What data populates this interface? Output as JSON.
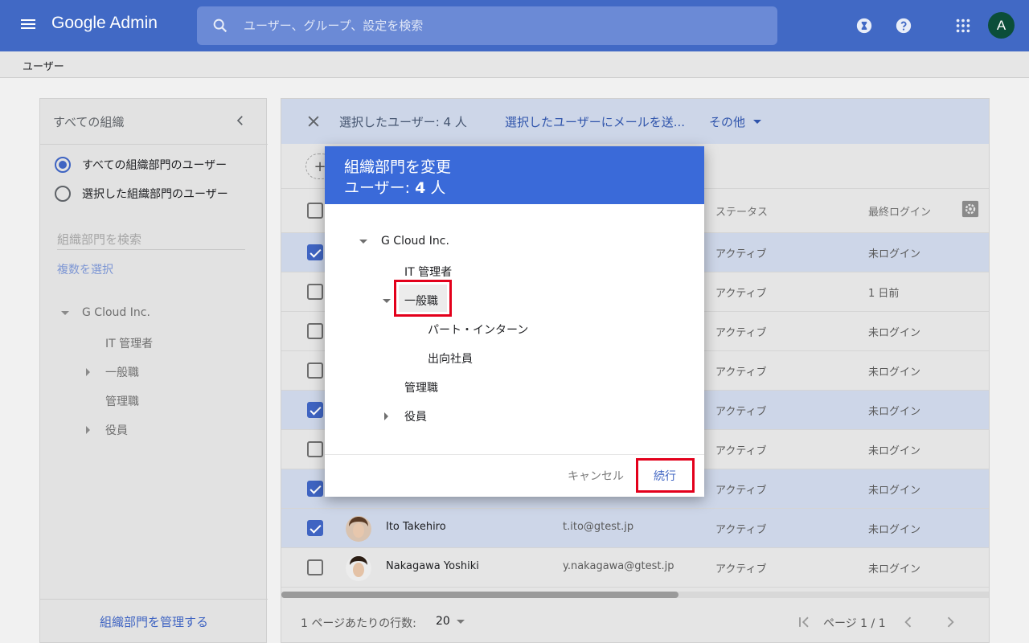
{
  "topbar": {
    "app_title": "Google Admin",
    "search_placeholder": "ユーザー、グループ、設定を検索",
    "avatar_letter": "A",
    "bar_color": "#4169c5"
  },
  "breadcrumb": "ユーザー",
  "left_panel": {
    "title": "すべての組織",
    "radio_all": "すべての組織部門のユーザー",
    "radio_selected": "選択した組織部門のユーザー",
    "search_placeholder": "組織部門を検索",
    "multi_select": "複数を選択",
    "tree": {
      "root": "G Cloud Inc.",
      "it_admin": "IT 管理者",
      "general": "一般職",
      "management": "管理職",
      "executives": "役員"
    },
    "manage_link": "組織部門を管理する"
  },
  "main": {
    "selection_text": "選択したユーザー: 4 人",
    "mail_action": "選択したユーザーにメールを送...",
    "more_action": "その他",
    "columns": {
      "status": "ステータス",
      "last_login": "最終ログイン"
    },
    "rows": [
      {
        "name": "",
        "email": "",
        "status": "アクティブ",
        "last_login": "未ログイン",
        "checked": true
      },
      {
        "name": "",
        "email": "",
        "status": "アクティブ",
        "last_login": "1 日前",
        "checked": false
      },
      {
        "name": "",
        "email": "",
        "status": "アクティブ",
        "last_login": "未ログイン",
        "checked": false
      },
      {
        "name": "",
        "email": "",
        "status": "アクティブ",
        "last_login": "未ログイン",
        "checked": false
      },
      {
        "name": "",
        "email": "",
        "status": "アクティブ",
        "last_login": "未ログイン",
        "checked": true
      },
      {
        "name": "",
        "email": "",
        "status": "アクティブ",
        "last_login": "未ログイン",
        "checked": false
      },
      {
        "name": "",
        "email": "",
        "status": "アクティブ",
        "last_login": "未ログイン",
        "checked": true
      },
      {
        "name": "Ito Takehiro",
        "email": "t.ito@gtest.jp",
        "status": "アクティブ",
        "last_login": "未ログイン",
        "checked": true
      },
      {
        "name": "Nakagawa Yoshiki",
        "email": "y.nakagawa@gtest.jp",
        "status": "アクティブ",
        "last_login": "未ログイン",
        "checked": false
      }
    ],
    "pager": {
      "rows_per_page_label": "1 ページあたりの行数:",
      "rows_per_page_value": "20",
      "page_label": "ページ 1 / 1"
    }
  },
  "dialog": {
    "title": "組織部門を変更",
    "subtitle_prefix": "ユーザー: ",
    "subtitle_count": "4",
    "subtitle_suffix": " 人",
    "tree": {
      "root": "G Cloud Inc.",
      "it_admin": "IT 管理者",
      "general": "一般職",
      "part_intern": "パート・インターン",
      "seconded": "出向社員",
      "management": "管理職",
      "executives": "役員"
    },
    "cancel": "キャンセル",
    "continue": "続行",
    "header_color": "#3a6ad9",
    "highlight_color": "#e3001b"
  }
}
